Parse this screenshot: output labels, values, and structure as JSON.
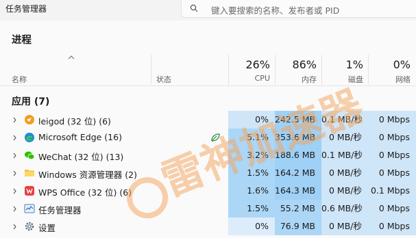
{
  "app": {
    "title": "任务管理器"
  },
  "search": {
    "placeholder": "键入要搜索的名称、发布者或 PID"
  },
  "page": {
    "title": "进程"
  },
  "columns": {
    "name": "名称",
    "status": "状态",
    "cpu": {
      "pct": "26%",
      "label": "CPU"
    },
    "memory": {
      "pct": "86%",
      "label": "内存"
    },
    "disk": {
      "pct": "1%",
      "label": "磁盘"
    },
    "network": {
      "pct": "0%",
      "label": "网络"
    }
  },
  "group": {
    "title": "应用 (7)"
  },
  "colors": {
    "heat_light": "#dcecfa",
    "heat_mid": "#cfe5f8",
    "heat_strong": "#acd6f6",
    "heat_deep": "#9fd0f5"
  },
  "processes": [
    {
      "name": "leigod (32 位) (6)",
      "icon": "leigod-icon",
      "status_icon": "",
      "cpu": "0%",
      "memory": "242.5 MB",
      "disk": "0.1 MB/秒",
      "network": "0 Mbps"
    },
    {
      "name": "Microsoft Edge (16)",
      "icon": "edge-icon",
      "status_icon": "efficiency-leaf-icon",
      "cpu": "5.1%",
      "memory": "353.6 MB",
      "disk": "0 MB/秒",
      "network": "0 Mbps"
    },
    {
      "name": "WeChat (32 位) (13)",
      "icon": "wechat-icon",
      "status_icon": "",
      "cpu": "3.2%",
      "memory": "188.6 MB",
      "disk": "0.1 MB/秒",
      "network": "0 Mbps"
    },
    {
      "name": "Windows 资源管理器 (2)",
      "icon": "folder-icon",
      "status_icon": "",
      "cpu": "1.5%",
      "memory": "164.2 MB",
      "disk": "0 MB/秒",
      "network": "0 Mbps"
    },
    {
      "name": "WPS Office (32 位) (6)",
      "icon": "wps-icon",
      "status_icon": "",
      "cpu": "1.6%",
      "memory": "164.3 MB",
      "disk": "0 MB/秒",
      "network": "0.1 Mbps"
    },
    {
      "name": "任务管理器",
      "icon": "task-manager-icon",
      "status_icon": "",
      "cpu": "1.5%",
      "memory": "55.2 MB",
      "disk": "0.6 MB/秒",
      "network": "0 Mbps"
    },
    {
      "name": "设置",
      "icon": "settings-gear-icon",
      "status_icon": "",
      "cpu": "0%",
      "memory": "76.9 MB",
      "disk": "0 MB/秒",
      "network": "0 Mbps"
    }
  ],
  "watermark": {
    "text": "雷神加速器"
  }
}
